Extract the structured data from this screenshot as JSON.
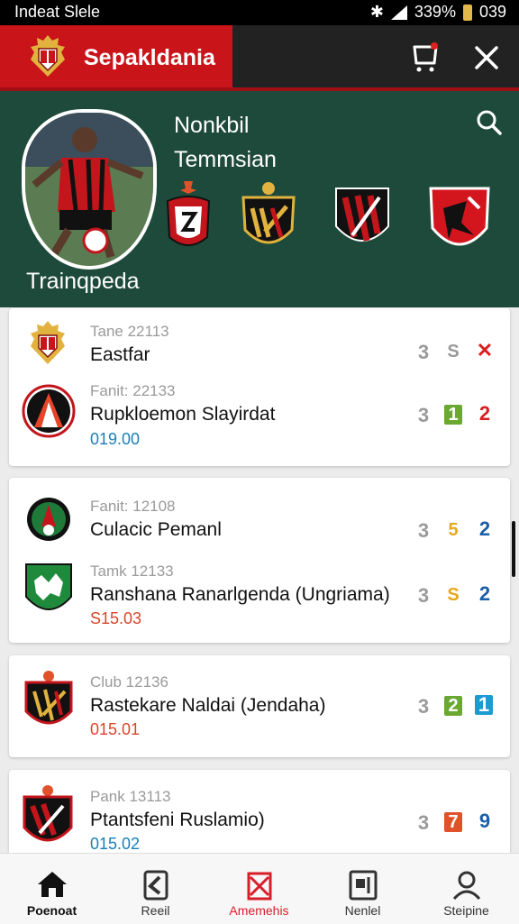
{
  "status_bar": {
    "left_text": "Indeat Slele",
    "battery_text": "339%",
    "time": "039"
  },
  "app_bar": {
    "title": "Sepakldania"
  },
  "hero": {
    "title_line1": "Nonkbil",
    "title_line2": "Temmsian",
    "caption": "Trainqpeda"
  },
  "matches": [
    {
      "rows": [
        {
          "meta": "Tane 22113",
          "name": "Eastfar",
          "price": "",
          "score1": "3",
          "score2": "S",
          "score3": "✕",
          "score3_color": "#d81e1e",
          "score2_color": "#9a9a9a",
          "badge2": "",
          "badge3": ""
        },
        {
          "meta": "Fanit: 22133",
          "name": "Rupkloemon Slayirdat",
          "price": "019.00",
          "price_color": "#1b7fb8",
          "score1": "3",
          "score2": "1",
          "score3": "2",
          "score3_color": "#d81e1e",
          "score2_color": "#ffffff",
          "badge2": "#6aa832",
          "badge3": ""
        }
      ]
    },
    {
      "rows": [
        {
          "meta": "Fanit: 12108",
          "name": "Culacic Pemanl",
          "price": "",
          "score1": "3",
          "score2": "5",
          "score3": "2",
          "score3_color": "#1b5fa8",
          "score2_color": "#e5a81f",
          "badge2": "",
          "badge3": ""
        },
        {
          "meta": "Tamk 12133",
          "name": "Ranshana Ranarlgenda (Ungriama)",
          "price": "S15.03",
          "price_color": "#d8452a",
          "score1": "3",
          "score2": "S",
          "score3": "2",
          "score3_color": "#1b5fa8",
          "score2_color": "#e5a81f",
          "badge2": "",
          "badge3": ""
        }
      ]
    },
    {
      "rows": [
        {
          "meta": "Club 12136",
          "name": "Rastekare Naldai (Jendaha)",
          "price": "015.01",
          "price_color": "#d8452a",
          "score1": "3",
          "score2": "2",
          "score3": "1",
          "score3_color": "#ffffff",
          "score2_color": "#ffffff",
          "badge2": "#6aa832",
          "badge3": "#1b9bd0"
        }
      ]
    },
    {
      "rows": [
        {
          "meta": "Pank 13113",
          "name": "Ptantsfeni Ruslamio)",
          "price": "015.02",
          "price_color": "#1b7fb8",
          "score1": "3",
          "score2": "7",
          "score3": "9",
          "score3_color": "#1b5fa8",
          "score2_color": "#ffffff",
          "badge2": "#e0532a",
          "badge3": ""
        }
      ]
    }
  ],
  "bottom_nav": [
    {
      "label": "Poenoat"
    },
    {
      "label": "Reeil"
    },
    {
      "label": "Amemehis",
      "active": true
    },
    {
      "label": "Nenlel"
    },
    {
      "label": "Steipine"
    }
  ],
  "colors": {
    "brand_red": "#c9141a",
    "hero_green": "#1d4a3a",
    "active_nav": "#d81e2a"
  }
}
